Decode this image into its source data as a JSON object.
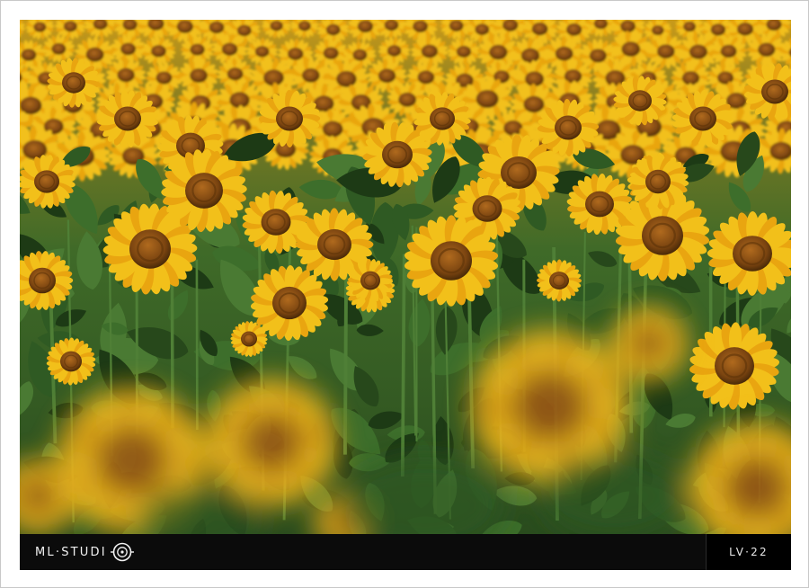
{
  "brand": {
    "label": "ML·STUDI",
    "logo_icon": "camera-lens-o-icon"
  },
  "badge": {
    "label": "LV·22"
  },
  "photo": {
    "subject_icon": "sunflower-icon",
    "colors": {
      "petal": "#f2c01a",
      "petal_deep": "#e9a510",
      "center": "#8a4e12",
      "center_dark": "#5a3208",
      "foliage": "#2f5a23",
      "foliage_dark": "#1d3a15",
      "bar": "#0b0b0b"
    }
  }
}
